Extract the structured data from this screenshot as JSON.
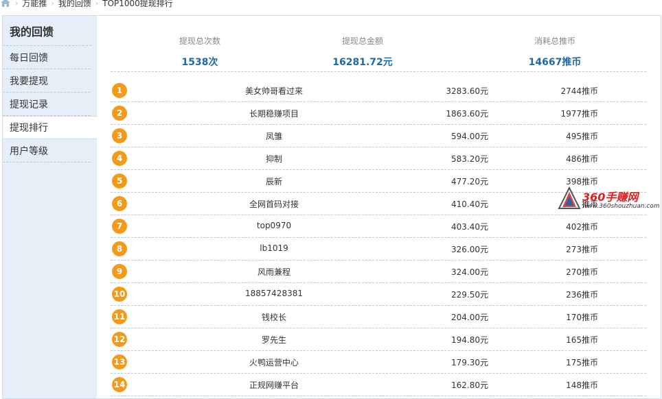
{
  "breadcrumb": {
    "items": [
      "万能推",
      "我的回馈",
      "TOP1000提现排行"
    ]
  },
  "sidebar": {
    "title": "我的回馈",
    "items": [
      {
        "label": "每日回馈",
        "active": false
      },
      {
        "label": "我要提现",
        "active": false
      },
      {
        "label": "提现记录",
        "active": false
      },
      {
        "label": "提现排行",
        "active": true
      },
      {
        "label": "用户等级",
        "active": false
      }
    ]
  },
  "stats": {
    "count_label": "提现总次数",
    "count_value": "1538次",
    "amount_label": "提现总金额",
    "amount_value": "16281.72元",
    "coins_label": "消耗总推币",
    "coins_value": "14667推币"
  },
  "ranking": [
    {
      "rank": "1",
      "name": "美女帅哥看过来",
      "amount": "3283.60元",
      "coins": "2744推币"
    },
    {
      "rank": "2",
      "name": "长期稳赚项目",
      "amount": "1863.60元",
      "coins": "1977推币"
    },
    {
      "rank": "3",
      "name": "凤雏",
      "amount": "594.00元",
      "coins": "495推币"
    },
    {
      "rank": "4",
      "name": "抑制",
      "amount": "583.20元",
      "coins": "486推币"
    },
    {
      "rank": "5",
      "name": "辰新",
      "amount": "477.20元",
      "coins": "398推币"
    },
    {
      "rank": "6",
      "name": "全网首码对接",
      "amount": "410.40元",
      "coins": "推币"
    },
    {
      "rank": "7",
      "name": "top0970",
      "amount": "403.40元",
      "coins": "402推币"
    },
    {
      "rank": "8",
      "name": "lb1019",
      "amount": "326.00元",
      "coins": "273推币"
    },
    {
      "rank": "9",
      "name": "风雨兼程",
      "amount": "324.00元",
      "coins": "270推币"
    },
    {
      "rank": "10",
      "name": "18857428381",
      "amount": "229.50元",
      "coins": "236推币"
    },
    {
      "rank": "11",
      "name": "钱校长",
      "amount": "204.00元",
      "coins": "170推币"
    },
    {
      "rank": "12",
      "name": "罗先生",
      "amount": "194.80元",
      "coins": "165推币"
    },
    {
      "rank": "13",
      "name": "火鸭运营中心",
      "amount": "179.30元",
      "coins": "175推币"
    },
    {
      "rank": "14",
      "name": "正规网赚平台",
      "amount": "162.80元",
      "coins": "148推币"
    }
  ],
  "watermark": {
    "brand": "360手赚网",
    "url": "www.360shouzhuan.com"
  },
  "colors": {
    "rank_badge": "#f39a1b",
    "stat_value": "#1f6aa5",
    "sidebar_bg": "#e6eff7"
  }
}
